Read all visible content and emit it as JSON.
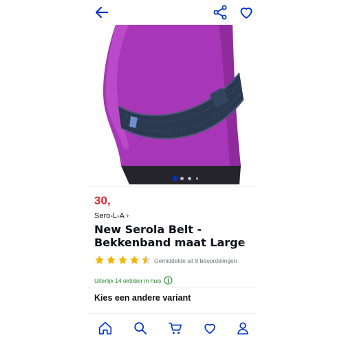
{
  "header": {
    "back_icon": "arrow-left-icon",
    "share_icon": "share-icon",
    "favorite_icon": "heart-icon",
    "accent_color": "#0033cc"
  },
  "gallery": {
    "image_description_icon": "product-photo",
    "total_images": 4,
    "active_index": 0
  },
  "product": {
    "price": "30,",
    "brand": "Sero-L-A ›",
    "title_line1": "New Serola Belt -",
    "title_line2": "Bekkenband maat Large",
    "rating": 4.5,
    "rating_text": "Gemiddelde uit 8 beoordelingen",
    "delivery_text": "Uiterlijk 14 oktober in huis",
    "variant_label": "Kies een andere variant",
    "price_color": "#e0282d",
    "star_color": "#f5b400",
    "delivery_color": "#238a2e"
  },
  "bottom_nav": {
    "items": [
      "home-icon",
      "search-icon",
      "cart-icon",
      "heart-icon",
      "account-icon"
    ]
  }
}
